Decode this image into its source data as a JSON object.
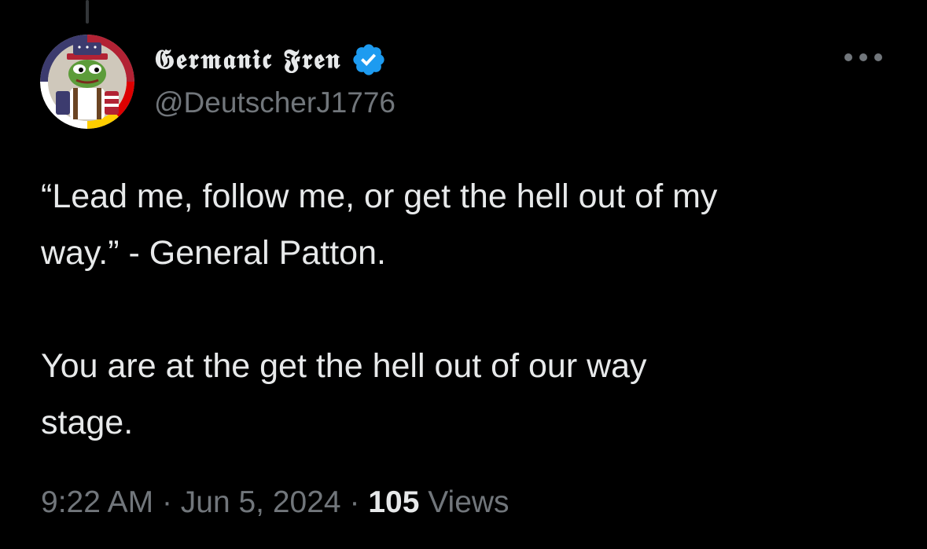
{
  "author": {
    "display_name": "𝕲𝖊𝖗𝖒𝖆𝖓𝖎𝖈 𝕱𝖗𝖊𝖓",
    "handle": "@DeutscherJ1776",
    "verified": true,
    "verified_color": "#1d9bf0",
    "avatar_icon": "frog-avatar-icon"
  },
  "more_icon": "more-options-icon",
  "tweet": {
    "text": "“Lead me, follow me, or get the hell out of my\nway.” - General Patton.\n\nYou are at the get the hell out of our way\nstage.",
    "time": "9:22 AM",
    "separator": "·",
    "date": "Jun 5, 2024",
    "views_count": "105",
    "views_label": "Views"
  },
  "colors": {
    "background": "#000000",
    "primary_text": "#e7e9ea",
    "secondary_text": "#71767b"
  }
}
